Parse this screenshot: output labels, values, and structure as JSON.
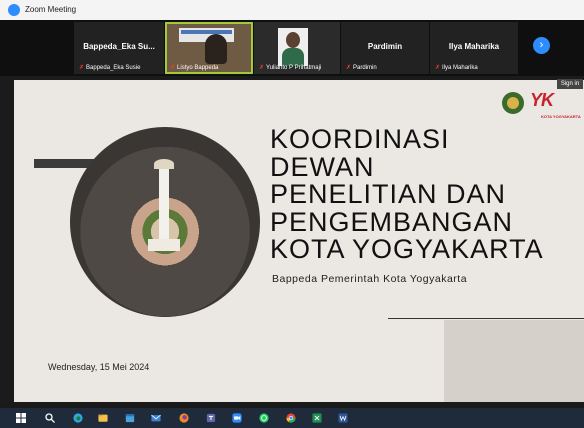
{
  "window": {
    "title": "Zoom Meeting"
  },
  "participants": [
    {
      "name": "Bappeda_Eka Su...",
      "label": "Bappeda_Eka Susie",
      "kind": "name"
    },
    {
      "name": "",
      "label": "Listyo Bappeda",
      "kind": "video"
    },
    {
      "name": "",
      "label": "Yulianto P Prihatmaji",
      "kind": "photo"
    },
    {
      "name": "Pardimin",
      "label": "Pardimin",
      "kind": "name"
    },
    {
      "name": "Ilya Maharika",
      "label": "Ilya Maharika",
      "kind": "name"
    }
  ],
  "controls": {
    "next_glyph": "›",
    "signin_label": "Sign in"
  },
  "slide": {
    "title_lines": [
      "KOORDINASI",
      "DEWAN",
      "PENELITIAN DAN",
      "PENGEMBANGAN",
      "KOTA YOGYAKARTA"
    ],
    "subtitle": "Bappeda Pemerintah Kota Yogyakarta",
    "date": "Wednesday, 15 Mei 2024",
    "logo_text": "YK",
    "logo_subtext": "KOTA YOGYAKARTA"
  },
  "taskbar": {
    "icons": [
      {
        "name": "windows-start-icon",
        "color": "#ffffff"
      },
      {
        "name": "search-icon",
        "color": "#ffffff"
      },
      {
        "name": "edge-browser-icon",
        "color": "#2ea8e0"
      },
      {
        "name": "file-explorer-icon",
        "color": "#f2c14e"
      },
      {
        "name": "calendar-app-icon",
        "color": "#4aa3df"
      },
      {
        "name": "mail-app-icon",
        "color": "#3b82d6"
      },
      {
        "name": "firefox-icon",
        "color": "#f08a24"
      },
      {
        "name": "teams-icon",
        "color": "#6264a7"
      },
      {
        "name": "zoom-app-icon",
        "color": "#2d8cff"
      },
      {
        "name": "whatsapp-icon",
        "color": "#25d366"
      },
      {
        "name": "chrome-icon",
        "color": "#ea4335"
      },
      {
        "name": "excel-icon",
        "color": "#1f8f4e"
      },
      {
        "name": "word-icon",
        "color": "#2b579a"
      }
    ]
  }
}
